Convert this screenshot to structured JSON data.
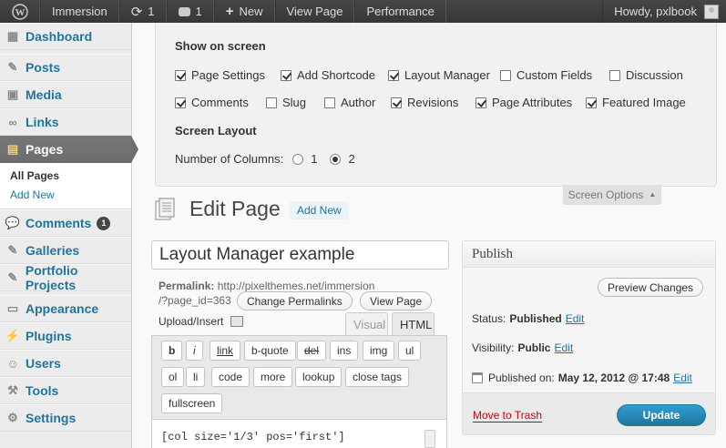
{
  "adminbar": {
    "site_name": "Immersion",
    "updates_count": "1",
    "comments_count": "1",
    "new_label": "New",
    "view_page": "View Page",
    "performance": "Performance",
    "howdy": "Howdy, pxlbook"
  },
  "sidebar": {
    "items": [
      {
        "label": "Dashboard",
        "icon": "dashboard-icon"
      },
      {
        "label": "Posts",
        "icon": "pin-icon"
      },
      {
        "label": "Media",
        "icon": "media-icon"
      },
      {
        "label": "Links",
        "icon": "link-icon"
      },
      {
        "label": "Pages",
        "icon": "pages-icon"
      },
      {
        "label": "Comments",
        "icon": "comment-icon",
        "badge": "1"
      },
      {
        "label": "Galleries",
        "icon": "pin-icon"
      },
      {
        "label": "Portfolio Projects",
        "icon": "pin-icon"
      },
      {
        "label": "Appearance",
        "icon": "appearance-icon"
      },
      {
        "label": "Plugins",
        "icon": "plugin-icon"
      },
      {
        "label": "Users",
        "icon": "users-icon"
      },
      {
        "label": "Tools",
        "icon": "tools-icon"
      },
      {
        "label": "Settings",
        "icon": "settings-icon"
      }
    ],
    "pages_submenu": [
      "All Pages",
      "Add New"
    ]
  },
  "screen_options": {
    "show_heading": "Show on screen",
    "checkboxes": [
      {
        "label": "Page Settings",
        "checked": true
      },
      {
        "label": "Add Shortcode",
        "checked": true
      },
      {
        "label": "Layout Manager",
        "checked": true
      },
      {
        "label": "Custom Fields",
        "checked": false
      },
      {
        "label": "Discussion",
        "checked": false
      },
      {
        "label": "Comments",
        "checked": true
      },
      {
        "label": "Slug",
        "checked": false
      },
      {
        "label": "Author",
        "checked": false
      },
      {
        "label": "Revisions",
        "checked": true
      },
      {
        "label": "Page Attributes",
        "checked": true
      },
      {
        "label": "Featured Image",
        "checked": true
      }
    ],
    "layout_heading": "Screen Layout",
    "columns_label": "Number of Columns:",
    "column_options": [
      "1",
      "2"
    ],
    "selected_columns": "2",
    "tab_label": "Screen Options"
  },
  "editor": {
    "title": "Edit Page",
    "add_new": "Add New",
    "post_title": "Layout Manager example",
    "permalink_label": "Permalink:",
    "permalink_url_1": "http://pixelthemes.net/immersion",
    "permalink_url_2": "/?page_id=363",
    "change_permalinks": "Change Permalinks",
    "view_page": "View Page",
    "upload_insert": "Upload/Insert",
    "tab_visual": "Visual",
    "tab_html": "HTML",
    "quicktags": [
      "b",
      "i",
      "link",
      "b-quote",
      "del",
      "ins",
      "img",
      "ul",
      "ol",
      "li",
      "code",
      "more",
      "lookup",
      "close tags",
      "fullscreen"
    ],
    "content": "[col size='1/3' pos='first']"
  },
  "publish": {
    "heading": "Publish",
    "preview": "Preview Changes",
    "status_label": "Status:",
    "status_value": "Published",
    "visibility_label": "Visibility:",
    "visibility_value": "Public",
    "published_on_label": "Published on:",
    "published_on_value": "May 12, 2012 @ 17:48",
    "edit": "Edit",
    "trash": "Move to Trash",
    "update": "Update"
  }
}
